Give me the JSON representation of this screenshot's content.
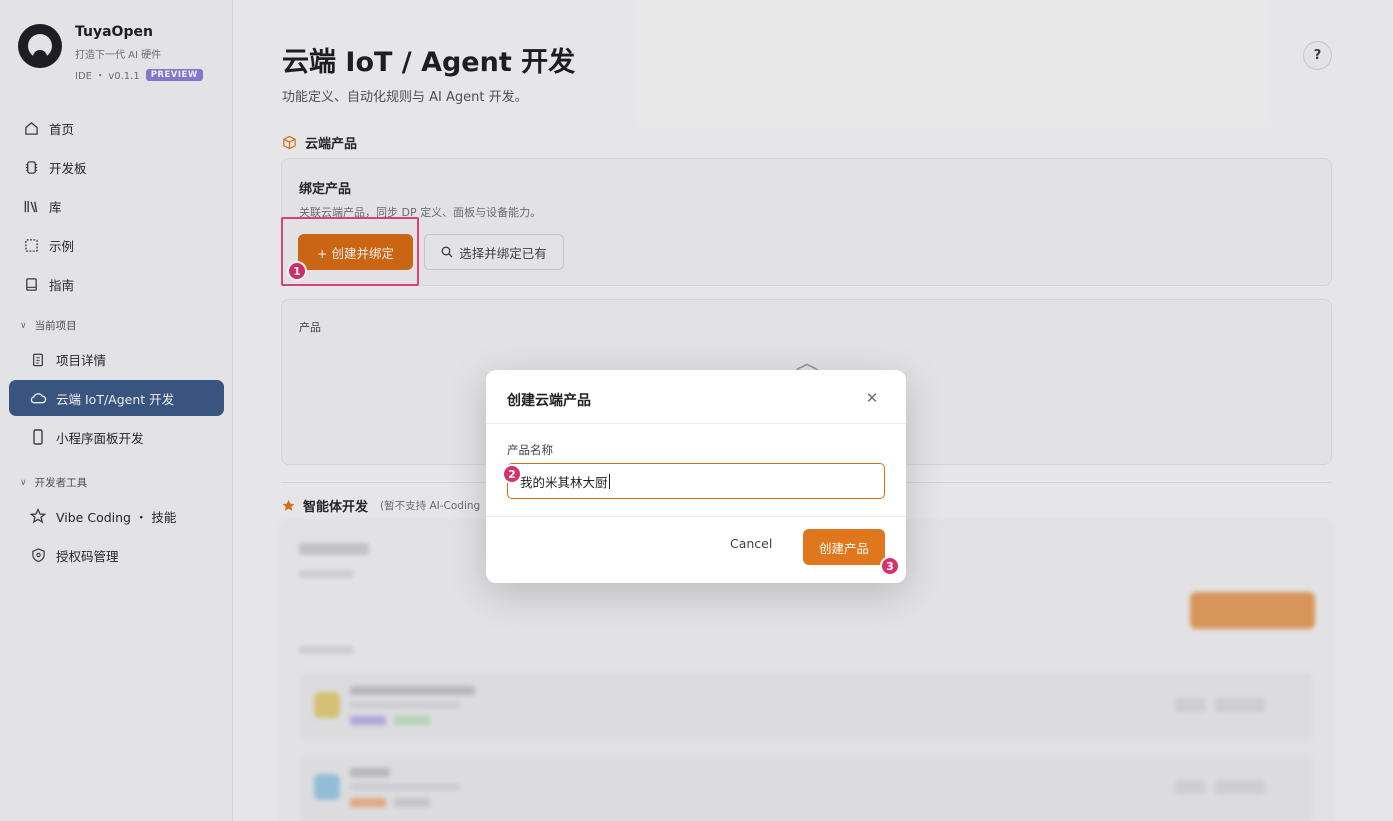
{
  "brand": {
    "name": "TuyaOpen",
    "tagline": "打造下一代 AI 硬件",
    "version": "IDE ・ v0.1.1",
    "badge": "PREVIEW"
  },
  "sidebar": {
    "items": [
      {
        "label": "首页",
        "icon": "home-icon"
      },
      {
        "label": "开发板",
        "icon": "chip-icon"
      },
      {
        "label": "库",
        "icon": "library-icon"
      },
      {
        "label": "示例",
        "icon": "example-icon"
      },
      {
        "label": "指南",
        "icon": "book-icon"
      }
    ],
    "section_project": "当前项目",
    "project_items": [
      {
        "label": "项目详情",
        "icon": "clipboard-icon"
      },
      {
        "label": "云端 IoT/Agent 开发",
        "icon": "cloud-icon",
        "active": true
      },
      {
        "label": "小程序面板开发",
        "icon": "phone-icon"
      }
    ],
    "section_tools": "开发者工具",
    "tool_items": [
      {
        "label": "Vibe Coding ・ 技能",
        "icon": "star-icon"
      },
      {
        "label": "授权码管理",
        "icon": "shield-key-icon"
      }
    ]
  },
  "main": {
    "title": "云端 IoT / Agent 开发",
    "subtitle": "功能定义、自动化规则与 AI Agent 开发。",
    "help": "?",
    "cloud_section": "云端产品",
    "bind_card": {
      "title": "绑定产品",
      "desc": "关联云端产品，同步 DP 定义、面板与设备能力。",
      "create_bind": "+ 创建并绑定",
      "select_bind": "选择并绑定已有"
    },
    "product_card": {
      "label": "产品"
    },
    "agent_section": "智能体开发",
    "agent_note": "(暂不支持 AI-Coding"
  },
  "steps": [
    "1",
    "2",
    "3"
  ],
  "modal": {
    "title": "创建云端产品",
    "field_label": "产品名称",
    "field_value": "我的米其林大厨",
    "cancel": "Cancel",
    "create": "创建产品"
  },
  "colors": {
    "accent": "#e0771d",
    "active_nav": "#3d5a87",
    "step": "#d6336c"
  }
}
